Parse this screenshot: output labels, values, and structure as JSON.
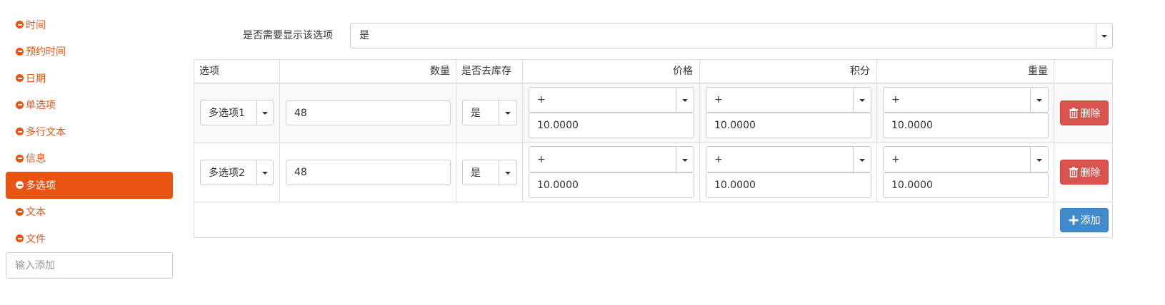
{
  "sidebar": {
    "items": [
      {
        "label": "时间"
      },
      {
        "label": "预约时间"
      },
      {
        "label": "日期"
      },
      {
        "label": "单选项"
      },
      {
        "label": "多行文本"
      },
      {
        "label": "信息"
      },
      {
        "label": "多选项"
      },
      {
        "label": "文本"
      },
      {
        "label": "文件"
      }
    ],
    "active_item": "多选项",
    "add_placeholder": "输入添加"
  },
  "show_option": {
    "label": "是否需要显示该选项",
    "value": "是"
  },
  "table": {
    "headers": {
      "option": "选项",
      "quantity": "数量",
      "deduct_stock": "是否去库存",
      "price": "价格",
      "points": "积分",
      "weight": "重量"
    },
    "rows": [
      {
        "option": "多选项1",
        "quantity": "48",
        "deduct_stock": "是",
        "price_op": "+",
        "price": "10.0000",
        "points_op": "+",
        "points": "10.0000",
        "weight_op": "+",
        "weight": "10.0000",
        "delete_label": "删除"
      },
      {
        "option": "多选项2",
        "quantity": "48",
        "deduct_stock": "是",
        "price_op": "+",
        "price": "10.0000",
        "points_op": "+",
        "points": "10.0000",
        "weight_op": "+",
        "weight": "10.0000",
        "delete_label": "删除"
      }
    ],
    "add_label": "添加"
  },
  "colors": {
    "accent": "#ea5413",
    "danger": "#d9534f",
    "primary": "#428bca"
  }
}
